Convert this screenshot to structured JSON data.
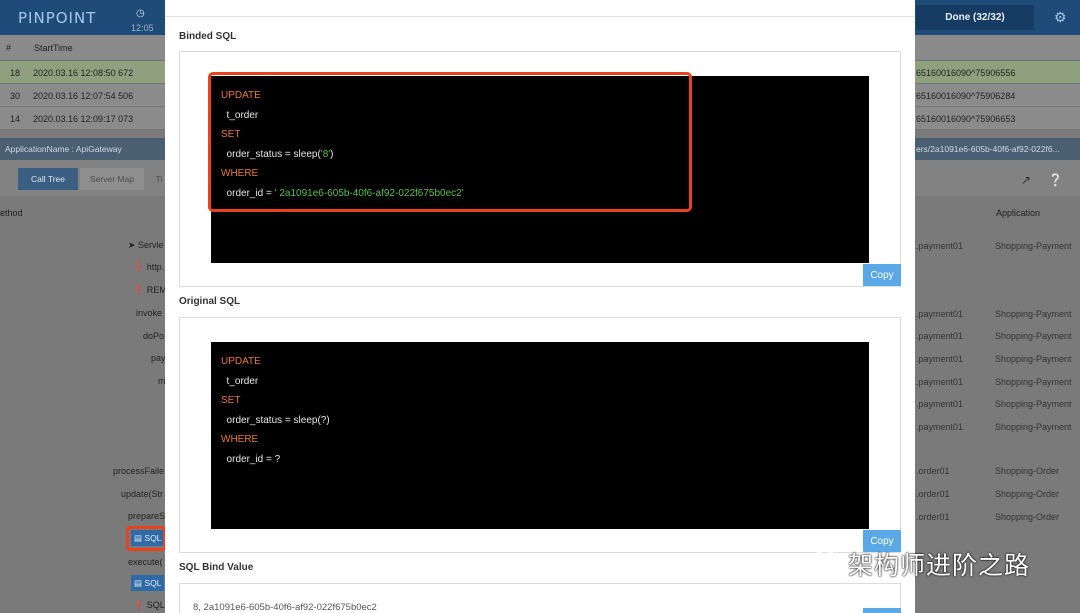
{
  "header": {
    "logo": "PINPOINT",
    "clock_label": "1",
    "clock_time": "12:05",
    "done_label": "Done (32/32)"
  },
  "table": {
    "col_index": "#",
    "col_start": "StartTime",
    "rows": [
      {
        "index": "18",
        "start": "2020.03.16 12:08:50 672",
        "txid": "65160016090^75906556"
      },
      {
        "index": "30",
        "start": "2020.03.16 12:07:54 506",
        "txid": "65160016090^75906284"
      },
      {
        "index": "14",
        "start": "2020.03.16 12:09:17 073",
        "txid": "65160016090^75906653"
      }
    ]
  },
  "app_bar": {
    "app_name": "ApplicationName : ApiGateway",
    "path_fragment": "ers/2a1091e6-605b-40f6-af92-022f6..."
  },
  "tabs": {
    "call_tree": "Call Tree",
    "server_map": "Server Map",
    "extra": "Ti"
  },
  "calltree": {
    "col_method": "ethod",
    "col_application": "Application",
    "left_items": [
      "Servle",
      "http.",
      "REM",
      "invoke",
      "doPo",
      "pay",
      "m",
      "processFaile",
      "update(Str",
      "prepareS",
      "SQL",
      "execute(",
      "SQL",
      "SQL"
    ],
    "right_agent": [
      ".payment01",
      ".payment01",
      ".payment01",
      ".payment01",
      ".payment01",
      ".payment01",
      ".payment01",
      ".order01",
      ".order01",
      ".order01"
    ],
    "right_app": [
      "Shopping-Payment",
      "Shopping-Payment",
      "Shopping-Payment",
      "Shopping-Payment",
      "Shopping-Payment",
      "Shopping-Payment",
      "Shopping-Payment",
      "Shopping-Order",
      "Shopping-Order",
      "Shopping-Order"
    ]
  },
  "modal": {
    "binded_title": "Binded SQL",
    "original_title": "Original SQL",
    "bind_value_title": "SQL Bind Value",
    "copy_label": "Copy",
    "binded_sql": {
      "kw_update": "UPDATE",
      "table": "  t_order",
      "kw_set": "SET",
      "assign_prefix": "  order_status = sleep(",
      "assign_value": "'8'",
      "assign_suffix": ")",
      "kw_where": "WHERE",
      "where_prefix": "  order_id = ",
      "where_value": "' 2a1091e6-605b-40f6-af92-022f675b0ec2'"
    },
    "original_sql": {
      "kw_update": "UPDATE",
      "table": "  t_order",
      "kw_set": "SET",
      "assign": "  order_status = sleep(?)",
      "kw_where": "WHERE",
      "where": "  order_id = ?"
    },
    "bind_value": "8, 2a1091e6-605b-40f6-af92-022f675b0ec2"
  },
  "watermark": {
    "text": "架构师进阶之路"
  },
  "colors": {
    "keyword": "#e77a30",
    "string": "#5ac14a",
    "highlight": "#e8431e",
    "copy_button": "#5aa9e6"
  }
}
